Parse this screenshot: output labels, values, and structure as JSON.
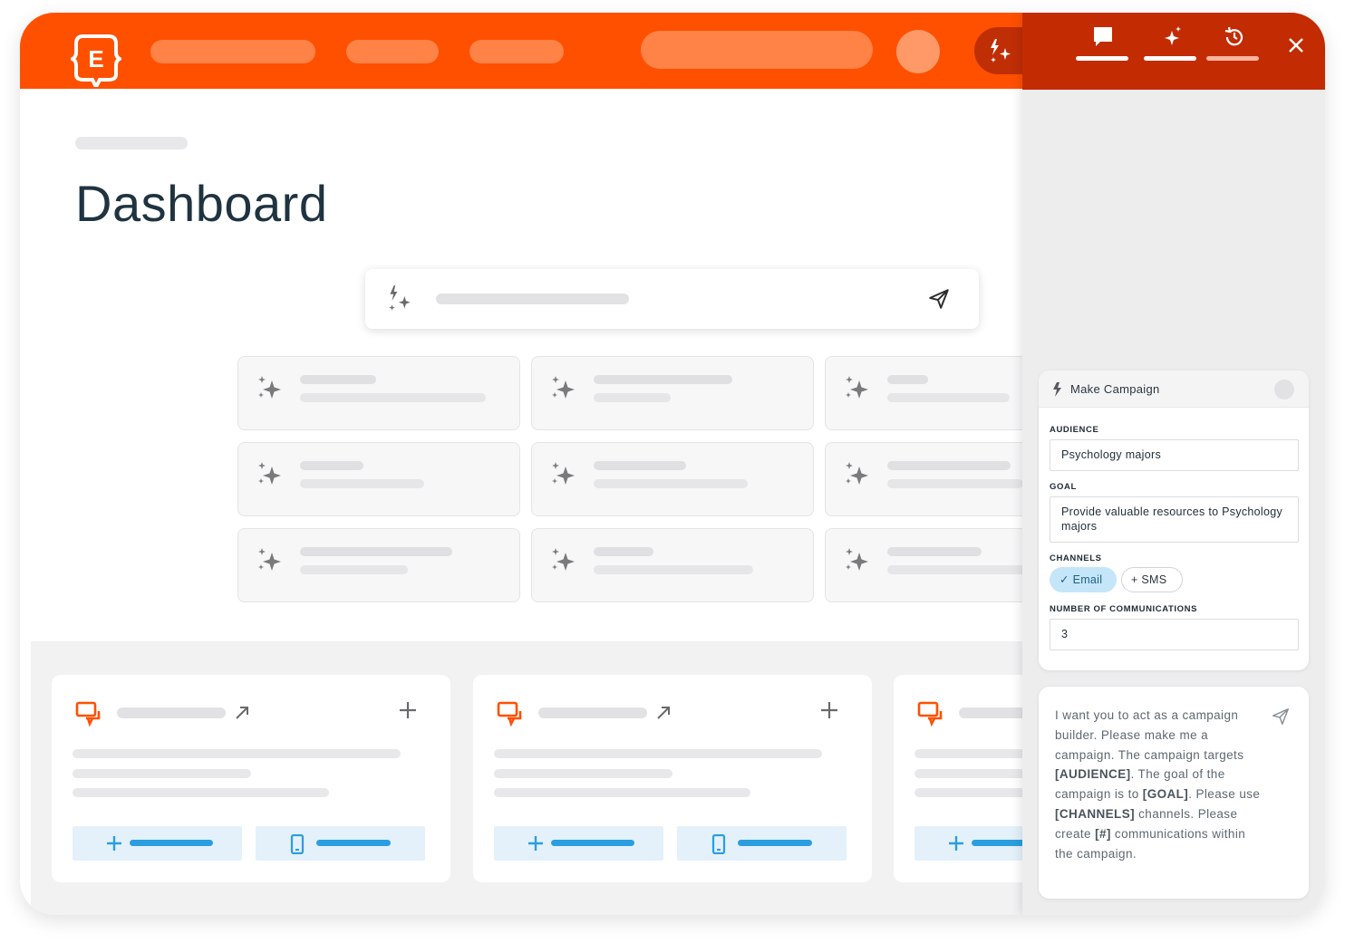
{
  "colors": {
    "brand": "#ff5000",
    "panel_header": "#c32b03",
    "accent_blue": "#2a9ee0"
  },
  "header": {
    "logo_letter": "E",
    "icons": [
      "chat-icon",
      "sparkle-icon",
      "history-icon",
      "close-icon"
    ]
  },
  "page": {
    "title": "Dashboard"
  },
  "make_campaign": {
    "title": "Make Campaign",
    "audience_label": "AUDIENCE",
    "audience_value": "Psychology majors",
    "goal_label": "GOAL",
    "goal_value": "Provide valuable resources to Psychology majors",
    "channels_label": "CHANNELS",
    "channels": [
      {
        "label": "Email",
        "selected": true,
        "icon": "check-icon"
      },
      {
        "label": "SMS",
        "selected": false,
        "icon": "plus-icon"
      }
    ],
    "communications_label": "NUMBER OF COMMUNICATIONS",
    "communications_value": "3"
  },
  "message": {
    "parts": [
      "I want you to act as a campaign builder. Please make me a campaign. The campaign targets ",
      "[AUDIENCE]",
      ". The goal of the campaign is to ",
      "[GOAL]",
      ". Please use ",
      "[CHANNELS]",
      " channels. Please create ",
      "[#]",
      " communications within the campaign."
    ]
  }
}
